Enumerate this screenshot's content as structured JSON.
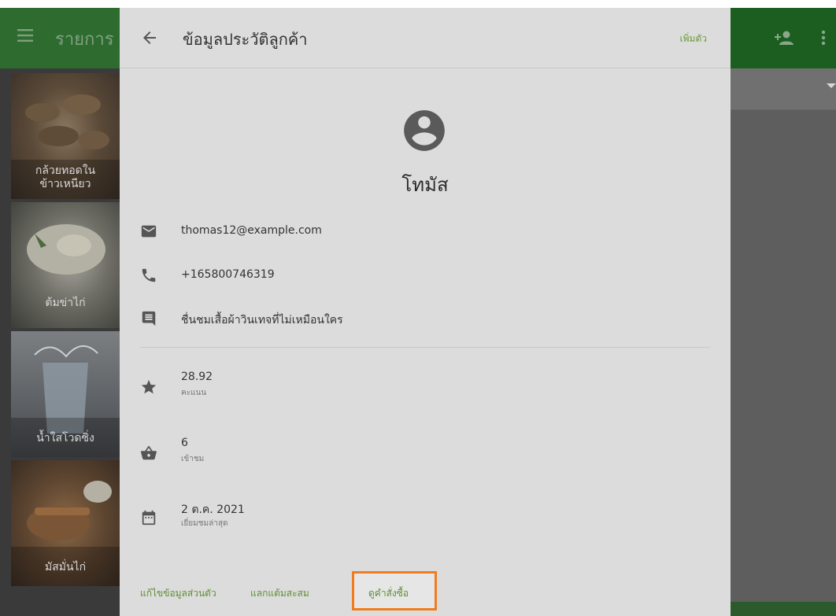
{
  "app": {
    "title": "รายการ",
    "colors": {
      "appbar": "#1b5e20",
      "accent": "#6a9a3a",
      "highlight": "#f07c1f"
    }
  },
  "tiles": [
    {
      "label": "กล้วยทอดใน\nข้าวเหนียว"
    },
    {
      "label": "ต้มข่าไก่"
    },
    {
      "label": "น้ำใสโวดซิ่ง"
    },
    {
      "label": "มัสมั่นไก่"
    }
  ],
  "dialog": {
    "title": "ข้อมูลประวัติลูกค้า",
    "add_label": "เพิ่มตัว",
    "name": "โทมัส",
    "contact": {
      "email": "thomas12@example.com",
      "phone": "+165800746319",
      "note": "ชื่นชมเสื้อผ้าวินเทจที่ไม่เหมือนใคร"
    },
    "stats": {
      "score": {
        "value": "28.92",
        "label": "คะแนน"
      },
      "visits": {
        "value": "6",
        "label": "เข้าชม"
      },
      "last_visit": {
        "value": "2 ต.ค. 2021",
        "label": "เยี่ยมชมล่าสุด"
      }
    },
    "actions": {
      "edit": "แก้ไขข้อมูลส่วนตัว",
      "redeem": "แลกแต้มสะสม",
      "orders": "ดูคำสั่งซื้อ"
    }
  },
  "icons": [
    "menu-icon",
    "add-person-icon",
    "more-vert-icon",
    "back-icon",
    "account-circle-icon",
    "email-icon",
    "phone-icon",
    "comment-icon",
    "star-icon",
    "basket-icon",
    "calendar-icon"
  ]
}
